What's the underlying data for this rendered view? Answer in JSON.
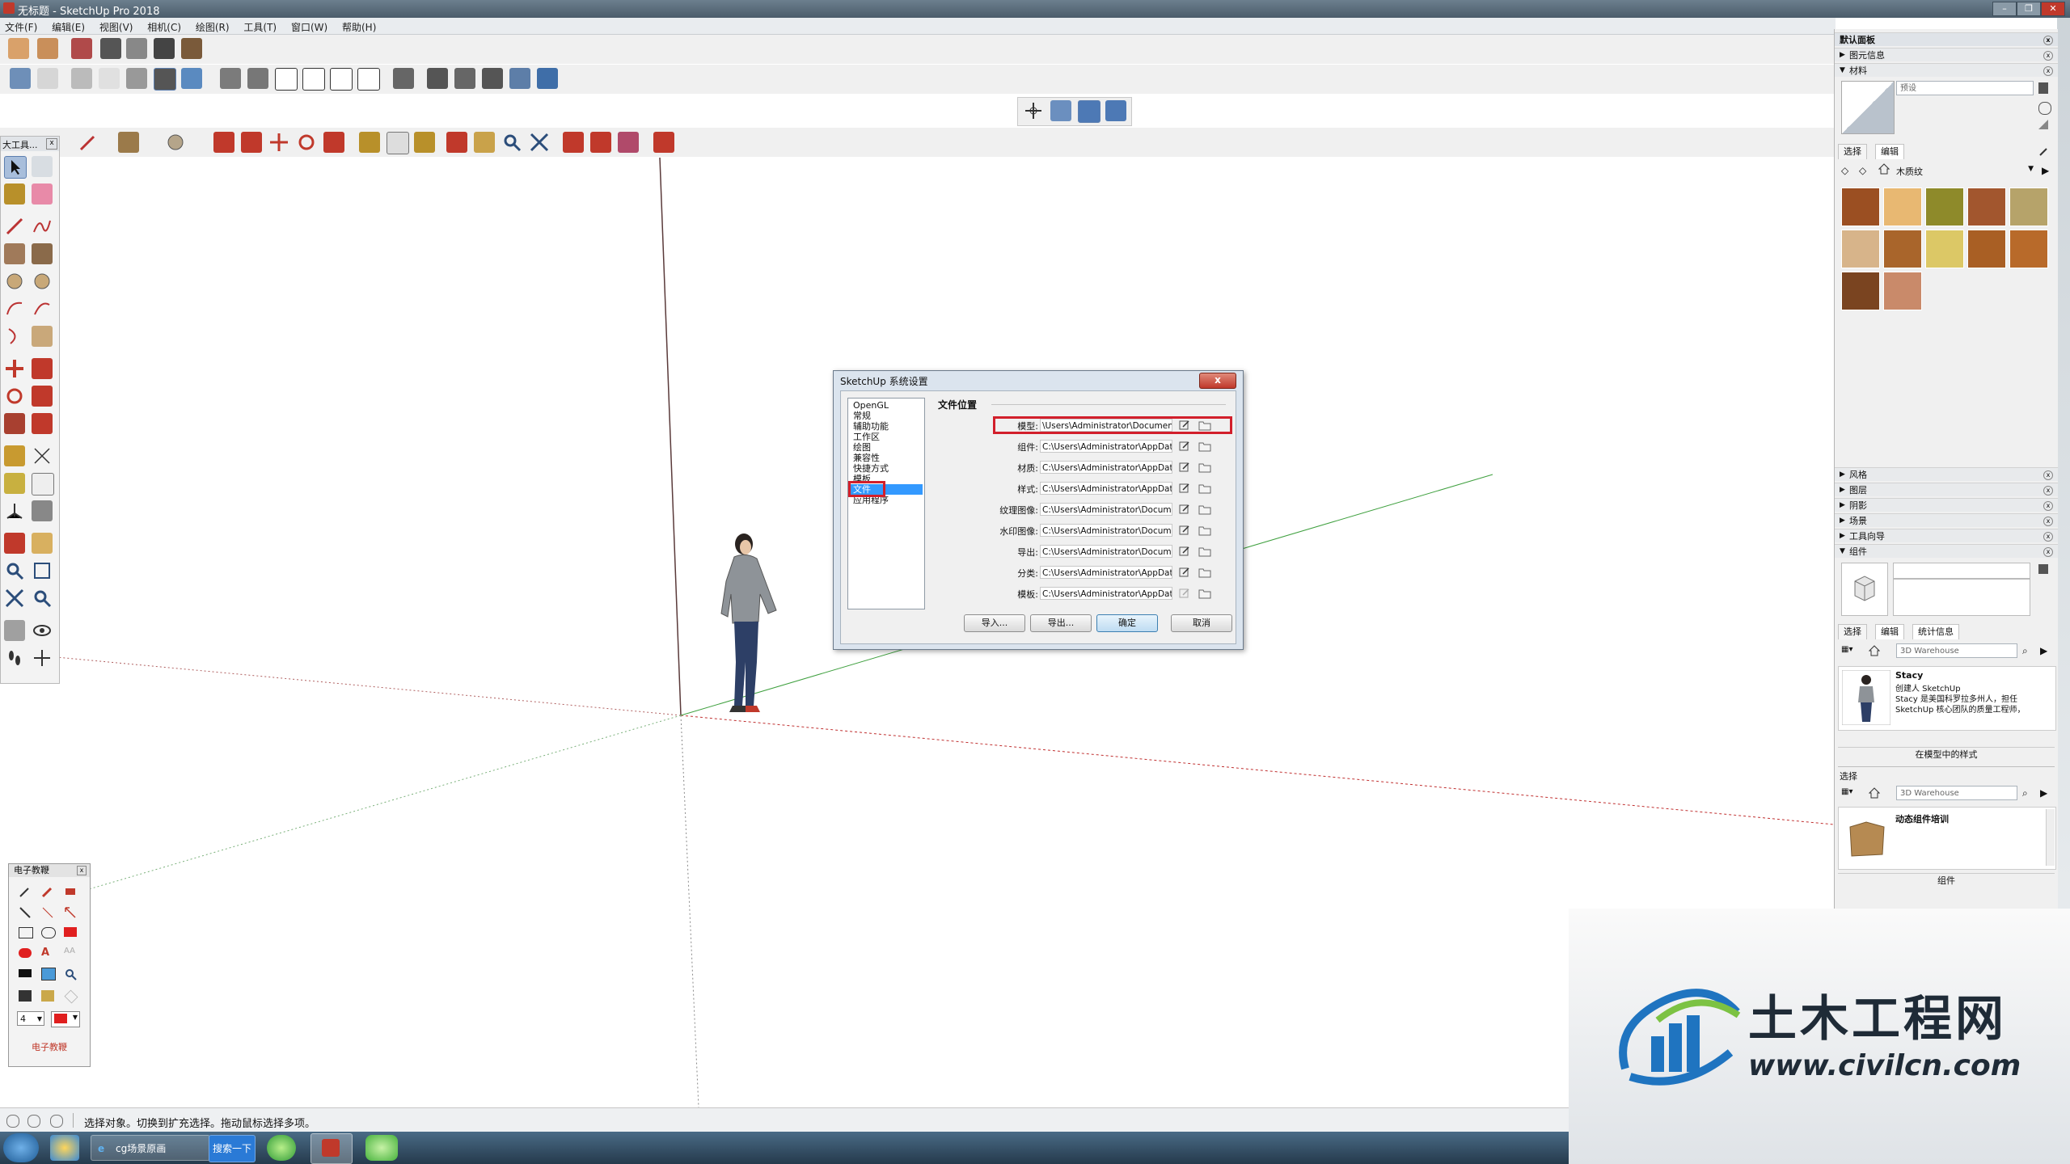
{
  "window": {
    "title": "无标题 - SketchUp Pro 2018"
  },
  "menu": [
    "文件(F)",
    "编辑(E)",
    "视图(V)",
    "相机(C)",
    "绘图(R)",
    "工具(T)",
    "窗口(W)",
    "帮助(H)"
  ],
  "palette": {
    "title": "大工具..."
  },
  "dialog": {
    "title": "SketchUp 系统设置",
    "close": "x",
    "nav": [
      "OpenGL",
      "常规",
      "辅助功能",
      "工作区",
      "绘图",
      "兼容性",
      "快捷方式",
      "模板",
      "文件",
      "应用程序"
    ],
    "active_nav": "文件",
    "section_title": "文件位置",
    "rows": [
      {
        "label": "模型:",
        "path": "\\Users\\Administrator\\Documents\\"
      },
      {
        "label": "组件:",
        "path": "C:\\Users\\Administrator\\AppData\\"
      },
      {
        "label": "材质:",
        "path": "C:\\Users\\Administrator\\AppData\\"
      },
      {
        "label": "样式:",
        "path": "C:\\Users\\Administrator\\AppData\\"
      },
      {
        "label": "纹理图像:",
        "path": "C:\\Users\\Administrator\\Document"
      },
      {
        "label": "水印图像:",
        "path": "C:\\Users\\Administrator\\Document"
      },
      {
        "label": "导出:",
        "path": "C:\\Users\\Administrator\\Document"
      },
      {
        "label": "分类:",
        "path": "C:\\Users\\Administrator\\AppData\\"
      },
      {
        "label": "模板:",
        "path": "C:\\Users\\Administrator\\AppData\\"
      }
    ],
    "buttons": {
      "import": "导入...",
      "export": "导出...",
      "ok": "确定",
      "cancel": "取消"
    }
  },
  "tray": {
    "title": "默认面板",
    "entity_info": "图元信息",
    "materials": {
      "label": "材料",
      "name_placeholder": "预设",
      "tab_select": "选择",
      "tab_edit": "编辑",
      "library": "木质纹",
      "swatch_colors": [
        "#9b4f22",
        "#e8b872",
        "#8e8a2a",
        "#a2562e",
        "#b6a36a",
        "#d7b48a",
        "#a9652b",
        "#dcc866",
        "#a95f24",
        "#b86a2a",
        "#7a4420",
        "#c98a6a"
      ]
    },
    "panels": [
      "风格",
      "图层",
      "阴影",
      "场景",
      "工具向导"
    ],
    "components": {
      "label": "组件",
      "tab_select": "选择",
      "tab_edit": "编辑",
      "tab_stats": "统计信息",
      "search_placeholder": "3D Warehouse",
      "item_name": "Stacy",
      "item_desc": [
        "创建人 SketchUp",
        "Stacy 是美国科罗拉多州人，担任",
        "SketchUp 核心团队的质量工程师，"
      ],
      "in_model": "在模型中的样式",
      "select_label": "选择",
      "search2_placeholder": "3D Warehouse",
      "item2_name": "动态组件培训",
      "footer": "组件"
    }
  },
  "tutor": {
    "title": "电子教鞭",
    "line_width": "4",
    "footer": "电子教鞭"
  },
  "status": {
    "message": "选择对象。切换到扩充选择。拖动鼠标选择多项。"
  },
  "taskbar": {
    "ie_label": "cg场景原画",
    "search_button": "搜索一下"
  },
  "watermark": {
    "cn": "土木工程网",
    "url": "www.civilcn.com"
  }
}
